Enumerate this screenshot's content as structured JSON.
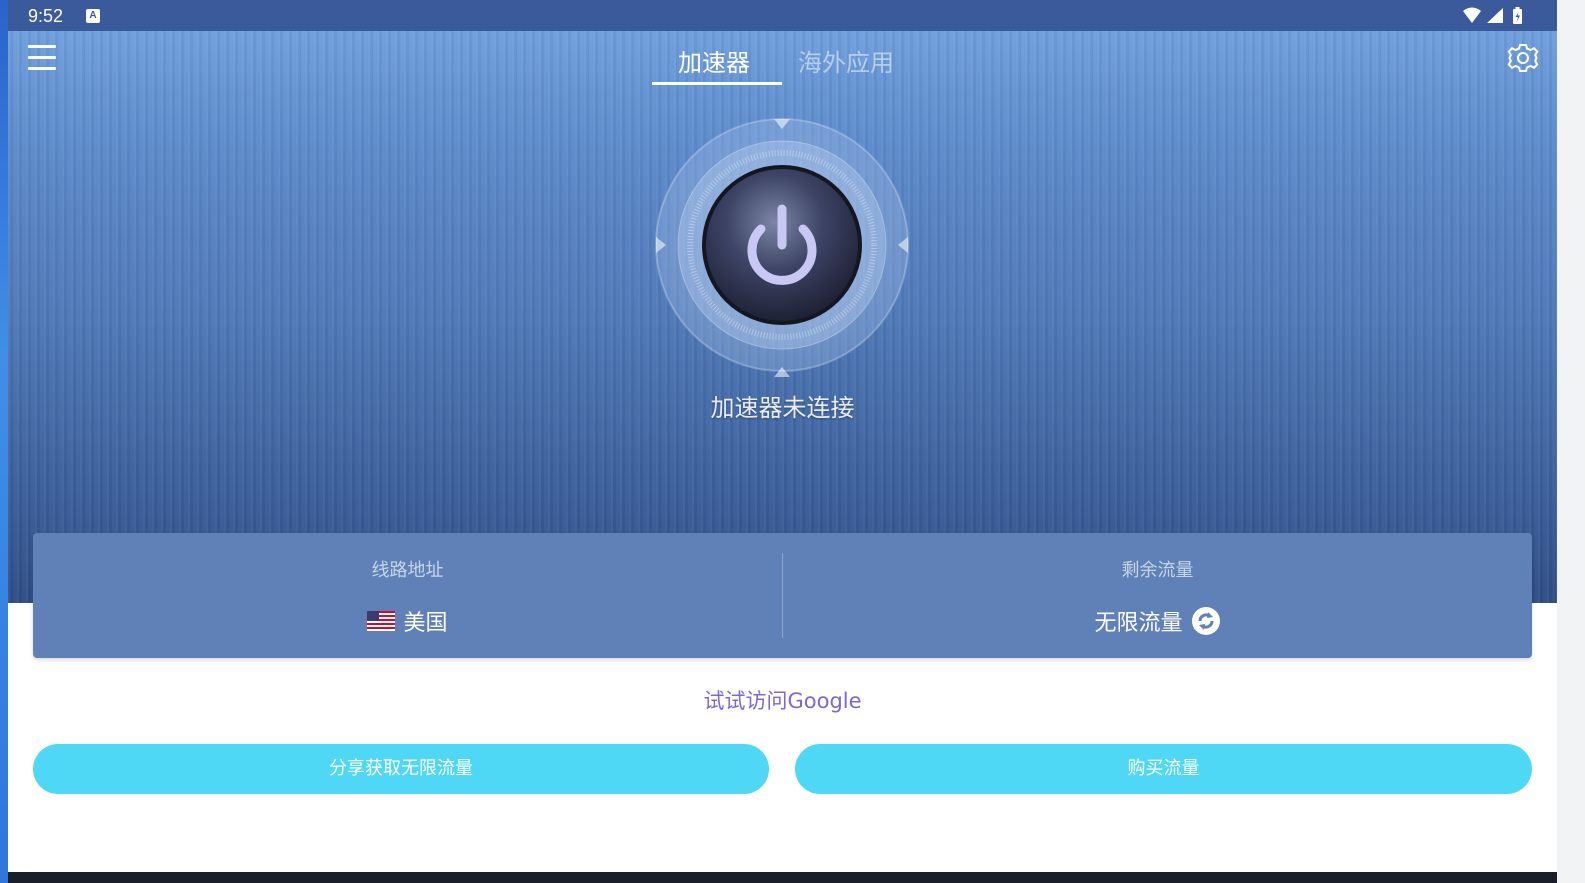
{
  "status_bar": {
    "time": "9:52",
    "notification_badge": "A",
    "icons": [
      "wifi-icon",
      "cell-signal-icon",
      "battery-icon"
    ]
  },
  "header": {
    "tabs": [
      {
        "label": "加速器",
        "active": true
      },
      {
        "label": "海外应用",
        "active": false
      }
    ],
    "menu_icon": "hamburger-icon",
    "settings_icon": "gear-icon"
  },
  "main": {
    "power_icon": "power-icon",
    "connection_status": "加速器未连接"
  },
  "info_card": {
    "route_label": "线路地址",
    "route_value": "美国",
    "route_flag_icon": "us-flag-icon",
    "traffic_label": "剩余流量",
    "traffic_value": "无限流量",
    "traffic_refresh_icon": "refresh-icon"
  },
  "actions": {
    "google_link": "试试访问Google",
    "share_button": "分享获取无限流量",
    "buy_button": "购买流量"
  },
  "colors": {
    "status_bar": "#3b5a9c",
    "card": "#5f81b8",
    "button": "#4fd8f5",
    "link": "#7b68d8"
  }
}
